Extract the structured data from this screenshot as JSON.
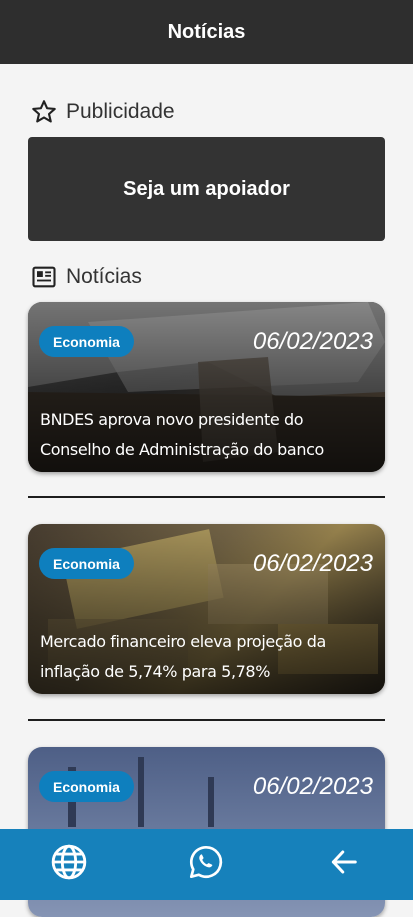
{
  "app": {
    "title": "Notícias"
  },
  "ad_section": {
    "heading": "Publicidade",
    "icon": "star-outline-icon",
    "cta_label": "Seja um apoiador"
  },
  "news_section": {
    "heading": "Notícias",
    "icon": "newspaper-icon"
  },
  "news": [
    {
      "category": "Economia",
      "date": "06/02/2023",
      "title": "BNDES aprova novo presidente do Conselho de Administração do banco"
    },
    {
      "category": "Economia",
      "date": "06/02/2023",
      "title": "Mercado financeiro eleva projeção da inflação de 5,74% para 5,78%"
    },
    {
      "category": "Economia",
      "date": "06/02/2023",
      "title": ""
    }
  ],
  "bottom_nav": [
    {
      "icon": "globe-icon"
    },
    {
      "icon": "whatsapp-icon"
    },
    {
      "icon": "arrow-back-icon"
    }
  ],
  "colors": {
    "appbar": "#2e2e2e",
    "badge": "#0e7fbe",
    "bottom_nav": "#1681bb"
  }
}
